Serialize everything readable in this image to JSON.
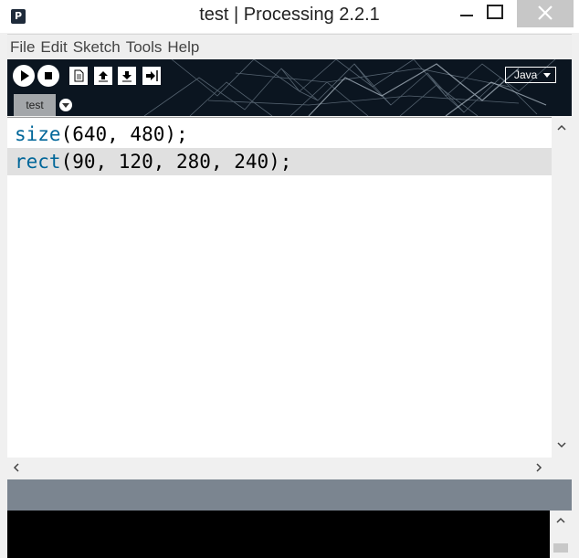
{
  "window": {
    "title": "test | Processing 2.2.1",
    "app_icon_letter": "P"
  },
  "menu": {
    "items": [
      "File",
      "Edit",
      "Sketch",
      "Tools",
      "Help"
    ]
  },
  "toolbar": {
    "mode": "Java",
    "accent_bg": "#0b1520"
  },
  "tabs": [
    {
      "label": "test",
      "active": true
    }
  ],
  "editor": {
    "lines": [
      {
        "keyword": "size",
        "rest": "(640, 480);",
        "highlighted": false
      },
      {
        "keyword": "rect",
        "rest": "(90, 120, 280, 240);",
        "highlighted": true
      }
    ],
    "keyword_color": "#006699"
  },
  "console": {
    "text": ""
  }
}
